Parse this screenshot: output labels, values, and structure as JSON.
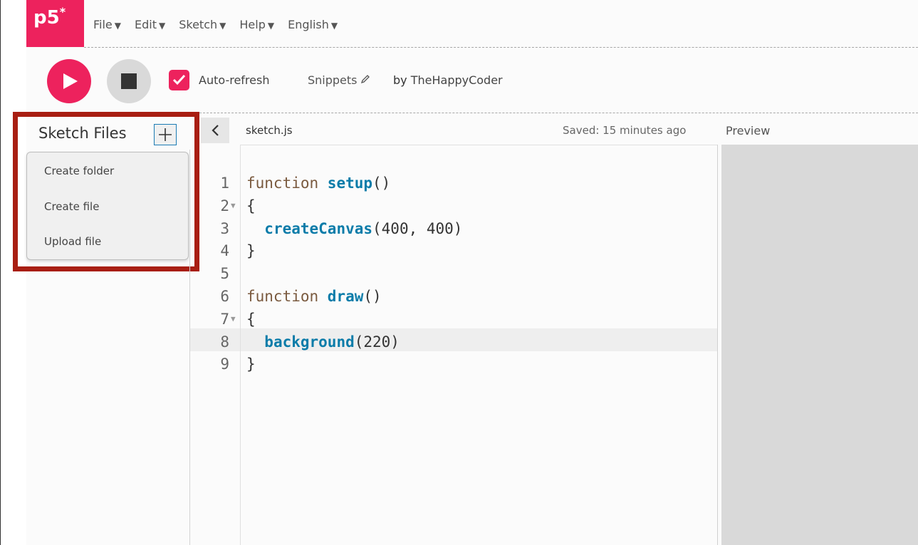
{
  "nav": {
    "logo": "p5",
    "logo_sup": "*",
    "menus": [
      {
        "label": "File"
      },
      {
        "label": "Edit"
      },
      {
        "label": "Sketch"
      },
      {
        "label": "Help"
      },
      {
        "label": "English"
      }
    ],
    "caret": "▼"
  },
  "toolbar": {
    "auto_refresh_label": "Auto-refresh",
    "auto_refresh_checked": true,
    "sketch_name": "Snippets",
    "by_prefix": "by",
    "author": "TheHappyCoder"
  },
  "sidebar": {
    "title": "Sketch Files",
    "dropdown_items": [
      "Create folder",
      "Create file",
      "Upload file"
    ]
  },
  "editor": {
    "file_name": "sketch.js",
    "saved_status": "Saved: 15 minutes ago",
    "highlighted_line": 8,
    "lines": [
      {
        "n": "1",
        "fold": "",
        "tokens": [
          [
            "kw",
            "function "
          ],
          [
            "fn",
            "setup"
          ],
          [
            "pl",
            "()"
          ]
        ]
      },
      {
        "n": "2",
        "fold": "▼",
        "tokens": [
          [
            "pl",
            "{"
          ]
        ]
      },
      {
        "n": "3",
        "fold": "",
        "tokens": [
          [
            "pl",
            "  "
          ],
          [
            "fn",
            "createCanvas"
          ],
          [
            "pl",
            "(400, 400)"
          ]
        ]
      },
      {
        "n": "4",
        "fold": "",
        "tokens": [
          [
            "pl",
            "}"
          ]
        ]
      },
      {
        "n": "5",
        "fold": "",
        "tokens": []
      },
      {
        "n": "6",
        "fold": "",
        "tokens": [
          [
            "kw",
            "function "
          ],
          [
            "fn",
            "draw"
          ],
          [
            "pl",
            "()"
          ]
        ]
      },
      {
        "n": "7",
        "fold": "▼",
        "tokens": [
          [
            "pl",
            "{"
          ]
        ]
      },
      {
        "n": "8",
        "fold": "",
        "tokens": [
          [
            "pl",
            "  "
          ],
          [
            "fn",
            "background"
          ],
          [
            "pl",
            "(220)"
          ]
        ]
      },
      {
        "n": "9",
        "fold": "",
        "tokens": [
          [
            "pl",
            "}"
          ]
        ]
      }
    ]
  },
  "preview": {
    "label": "Preview"
  },
  "colors": {
    "accent": "#ed225d",
    "highlight_border": "#a81e12",
    "function_name": "#0b7ca9",
    "keyword": "#7a5a3f"
  }
}
